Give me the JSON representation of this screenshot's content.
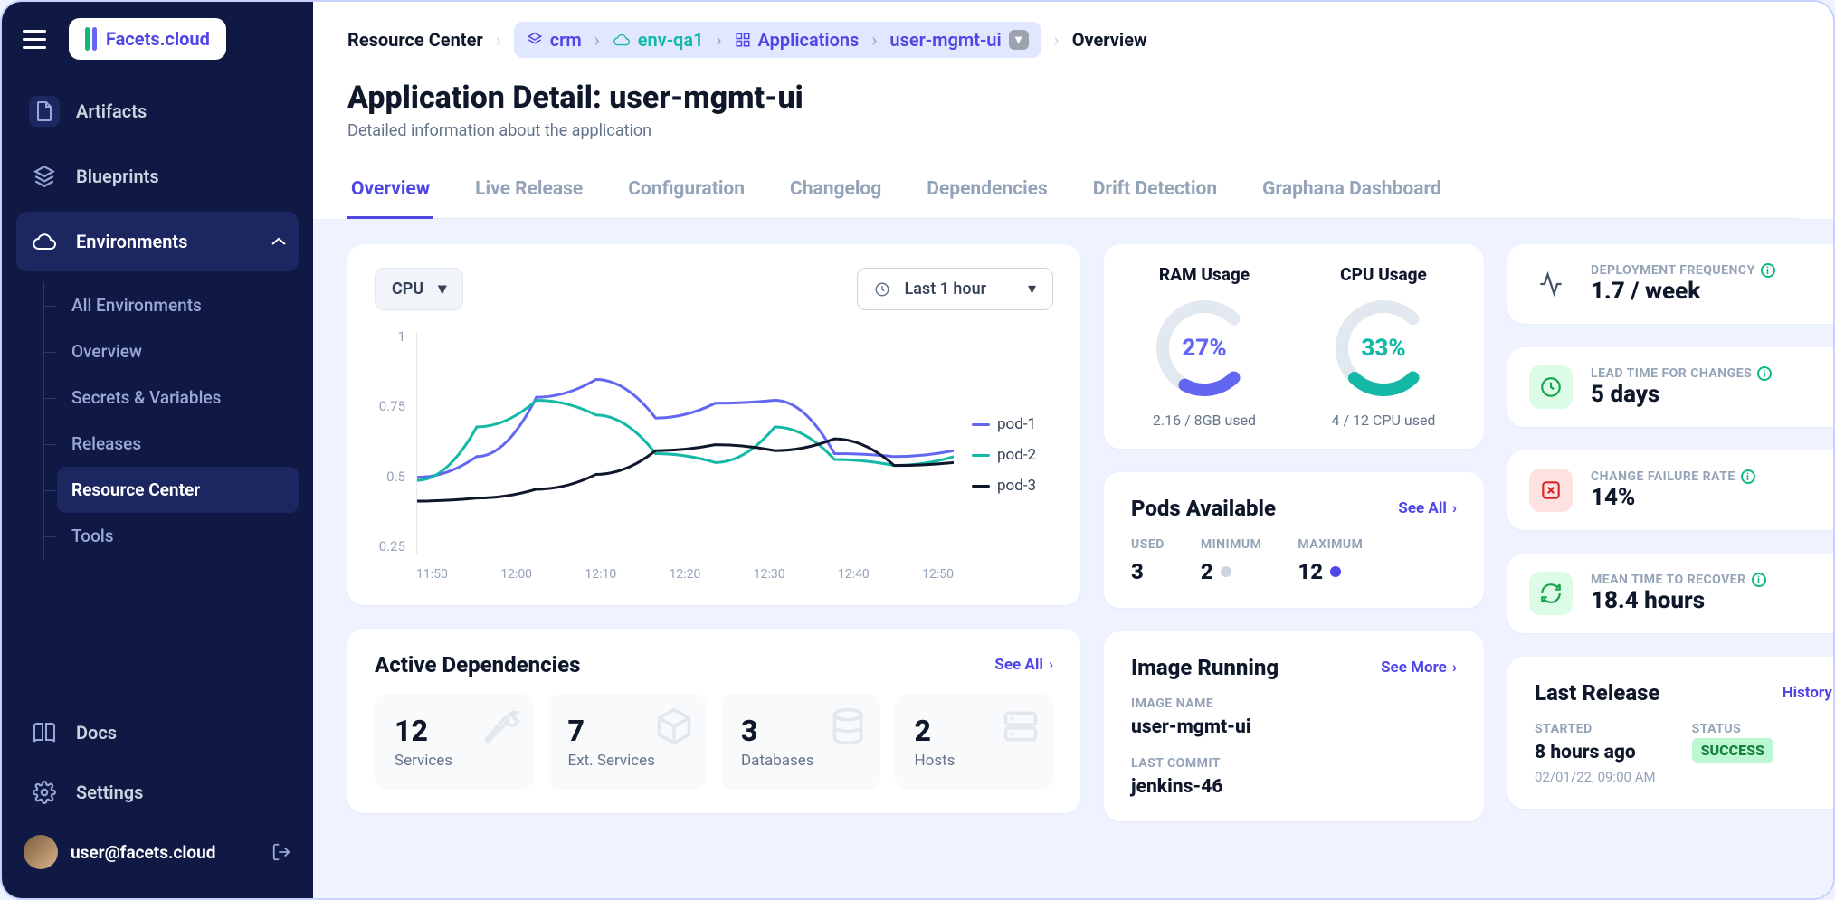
{
  "brand": {
    "name": "Facets.cloud"
  },
  "sidebar": {
    "items": [
      {
        "label": "Artifacts"
      },
      {
        "label": "Blueprints"
      },
      {
        "label": "Environments"
      },
      {
        "label": "Docs"
      },
      {
        "label": "Settings"
      }
    ],
    "env_sub": [
      {
        "label": "All Environments"
      },
      {
        "label": "Overview"
      },
      {
        "label": "Secrets & Variables"
      },
      {
        "label": "Releases"
      },
      {
        "label": "Resource Center"
      },
      {
        "label": "Tools"
      }
    ],
    "user": "user@facets.cloud"
  },
  "breadcrumb": {
    "root": "Resource Center",
    "crm": "crm",
    "env": "env-qa1",
    "apps": "Applications",
    "app": "user-mgmt-ui",
    "last": "Overview"
  },
  "page": {
    "title": "Application Detail: user-mgmt-ui",
    "subtitle": "Detailed information about the application"
  },
  "tabs": [
    "Overview",
    "Live Release",
    "Configuration",
    "Changelog",
    "Dependencies",
    "Drift Detection",
    "Graphana Dashboard"
  ],
  "chart_select": {
    "metric": "CPU",
    "range": "Last 1 hour"
  },
  "chart_data": {
    "type": "line",
    "title": "",
    "xlabel": "",
    "ylabel": "",
    "ylim": [
      0.25,
      1.0
    ],
    "y_ticks": [
      1,
      0.75,
      0.5,
      0.25
    ],
    "x_ticks": [
      "11:50",
      "12:00",
      "12:10",
      "12:20",
      "12:30",
      "12:40",
      "12:50"
    ],
    "series": [
      {
        "name": "pod-1",
        "color": "#6366f1",
        "values": [
          0.51,
          0.58,
          0.78,
          0.84,
          0.71,
          0.76,
          0.77,
          0.59,
          0.58,
          0.6
        ]
      },
      {
        "name": "pod-2",
        "color": "#14b8a6",
        "values": [
          0.5,
          0.68,
          0.77,
          0.72,
          0.59,
          0.56,
          0.68,
          0.57,
          0.55,
          0.58
        ]
      },
      {
        "name": "pod-3",
        "color": "#0f172a",
        "values": [
          0.43,
          0.44,
          0.47,
          0.52,
          0.6,
          0.62,
          0.6,
          0.64,
          0.55,
          0.56
        ]
      }
    ]
  },
  "gauges": {
    "ram": {
      "title": "RAM Usage",
      "percent": "27%",
      "value": 27,
      "sub": "2.16 / 8GB used",
      "color": "#6366f1"
    },
    "cpu": {
      "title": "CPU Usage",
      "percent": "33%",
      "value": 33,
      "sub": "4 / 12 CPU used",
      "color": "#14b8a6"
    }
  },
  "pods": {
    "title": "Pods Available",
    "see_all": "See All",
    "used_label": "USED",
    "used_val": "3",
    "min_label": "MINIMUM",
    "min_val": "2",
    "max_label": "MAXIMUM",
    "max_val": "12"
  },
  "image_running": {
    "title": "Image Running",
    "see_more": "See More",
    "name_label": "IMAGE NAME",
    "name_val": "user-mgmt-ui",
    "commit_label": "LAST COMMIT",
    "commit_val": "jenkins-46"
  },
  "metrics": [
    {
      "label": "DEPLOYMENT FREQUENCY",
      "value": "1.7 / week",
      "icon": "activity",
      "icon_bg": ""
    },
    {
      "label": "LEAD TIME FOR CHANGES",
      "value": "5 days",
      "icon": "clock",
      "icon_bg": "green"
    },
    {
      "label": "CHANGE FAILURE RATE",
      "value": "14%",
      "icon": "x",
      "icon_bg": "red"
    },
    {
      "label": "MEAN TIME TO RECOVER",
      "value": "18.4 hours",
      "icon": "refresh",
      "icon_bg": "green"
    }
  ],
  "dependencies": {
    "title": "Active Dependencies",
    "see_all": "See All",
    "items": [
      {
        "val": "12",
        "label": "Services",
        "icon": "wrench"
      },
      {
        "val": "7",
        "label": "Ext. Services",
        "icon": "box"
      },
      {
        "val": "3",
        "label": "Databases",
        "icon": "db"
      },
      {
        "val": "2",
        "label": "Hosts",
        "icon": "server"
      }
    ]
  },
  "last_release": {
    "title": "Last Release",
    "history": "History",
    "started_label": "STARTED",
    "started_val": "8 hours ago",
    "started_sub": "02/01/22, 09:00 AM",
    "status_label": "STATUS",
    "status_val": "SUCCESS"
  }
}
